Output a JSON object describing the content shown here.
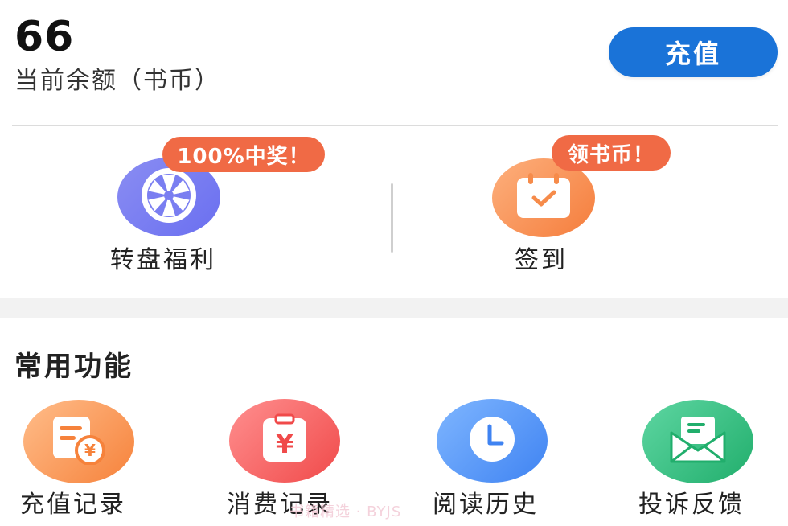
{
  "balance": {
    "value": "66",
    "label": "当前余额（书币）"
  },
  "recharge_button": {
    "label": "充值"
  },
  "promos": {
    "wheel": {
      "badge": "100%中奖！",
      "label": "转盘福利",
      "icon": "wheel-icon"
    },
    "checkin": {
      "badge": "领书币！",
      "label": "签到",
      "icon": "calendar-check-icon"
    }
  },
  "common_functions": {
    "title": "常用功能",
    "items": [
      {
        "label": "充值记录",
        "icon": "recharge-record-icon"
      },
      {
        "label": "消费记录",
        "icon": "consume-record-icon"
      },
      {
        "label": "阅读历史",
        "icon": "clock-icon"
      },
      {
        "label": "投诉反馈",
        "icon": "mail-icon"
      }
    ]
  },
  "watermark": {
    "text": "书籍精选 · BYJS"
  },
  "colors": {
    "primary_button": "#1a73d8",
    "badge": "#f06a45",
    "wheel": "#7a7ef1",
    "checkin": "#f68b4a",
    "recharge_record": "#f6823b",
    "consume_record": "#f04a4a",
    "history": "#3f83f2",
    "complaint": "#21ae6c"
  }
}
